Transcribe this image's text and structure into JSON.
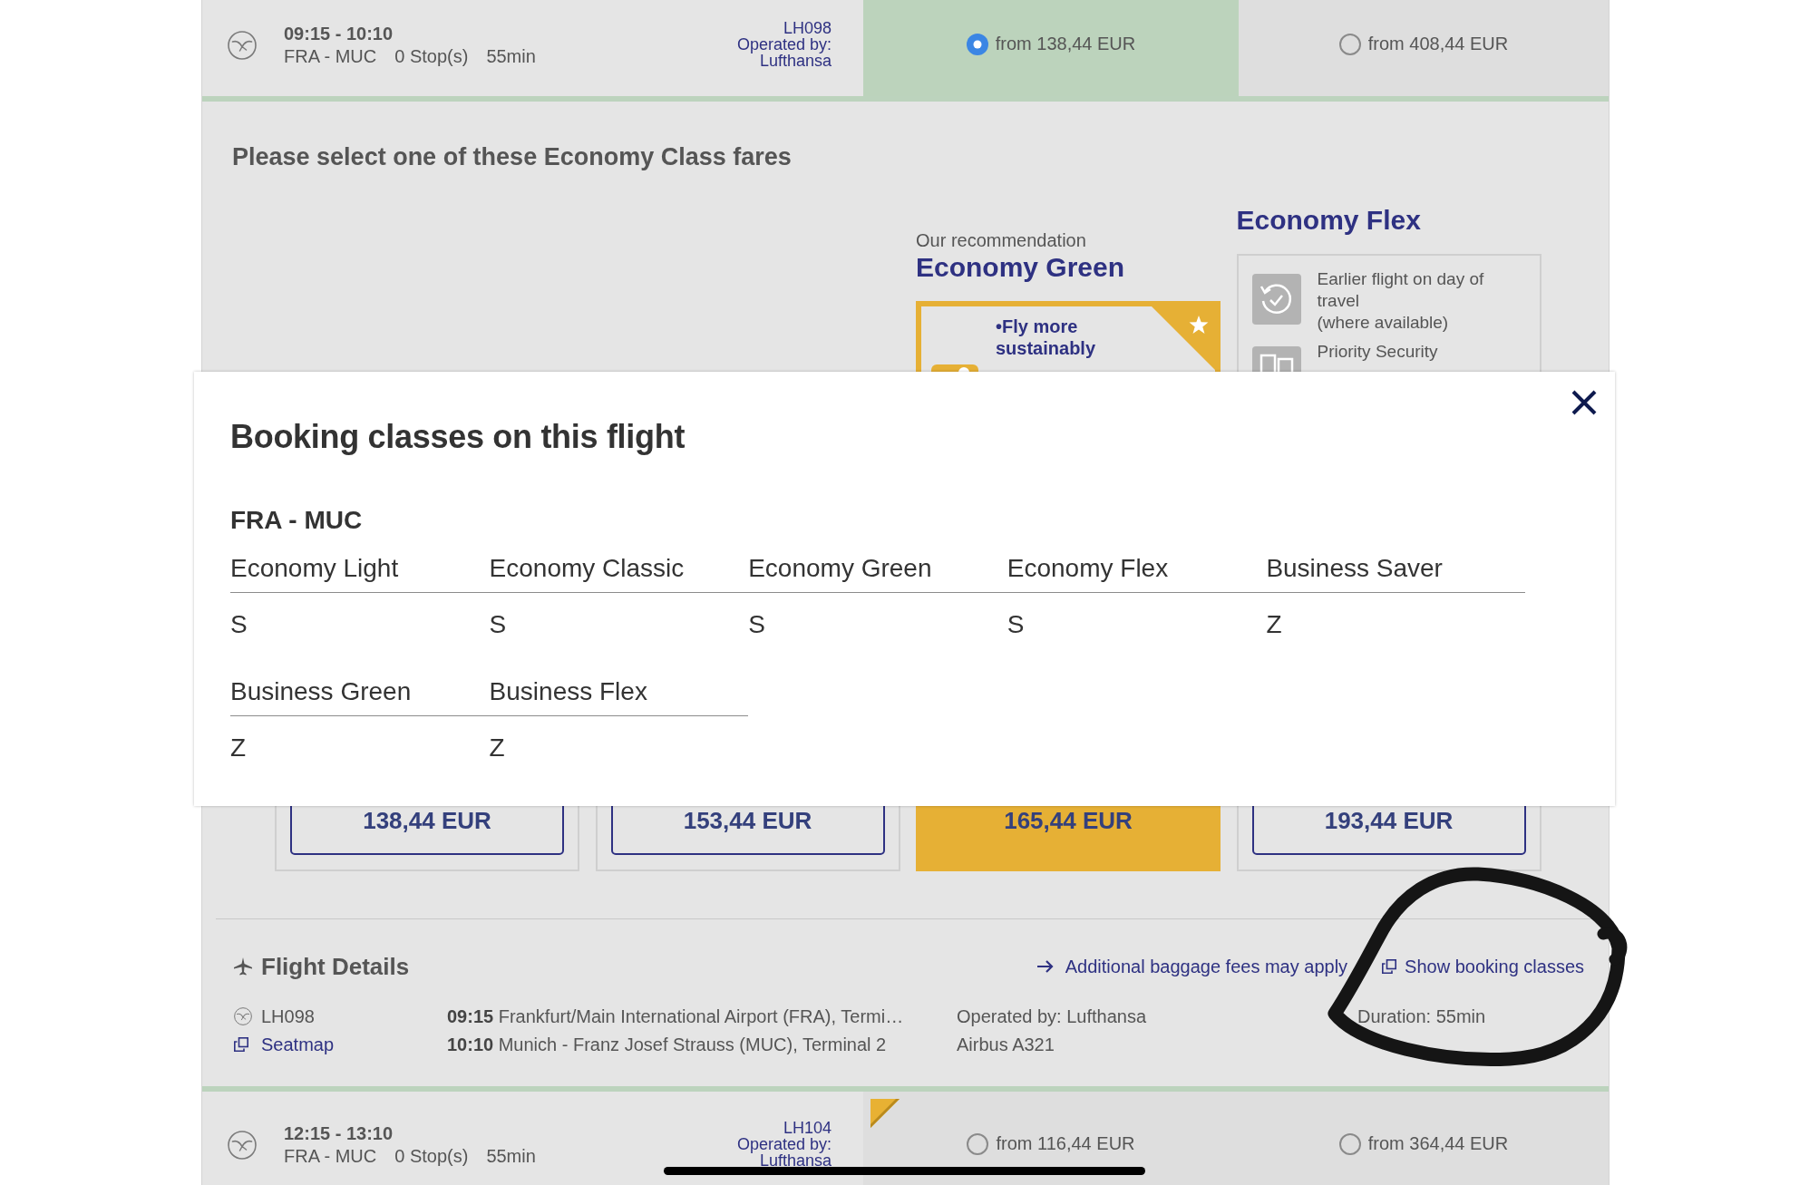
{
  "flights": [
    {
      "times": "09:15 - 10:10",
      "route": "FRA - MUC",
      "stops": "0 Stop(s)",
      "duration": "55min",
      "flight_number": "LH098",
      "operated_by": "Operated by:",
      "carrier": "Lufthansa",
      "fares": [
        {
          "label": "from 138,44 EUR",
          "selected": true,
          "flagged": false
        },
        {
          "label": "from 408,44 EUR",
          "selected": false,
          "flagged": false
        }
      ],
      "expanded": true,
      "fare_panel": {
        "heading": "Please select one of these Economy Class fares",
        "options": [
          {
            "kind": "standard",
            "price": "138,44 EUR"
          },
          {
            "kind": "standard",
            "price": "153,44 EUR"
          },
          {
            "kind": "recommended",
            "tagline": "Our recommendation",
            "name": "Economy Green",
            "features": [
              {
                "kind": "sustainability",
                "text": "•Fly more sustainably"
              }
            ],
            "price": "165,44 EUR"
          },
          {
            "kind": "standard",
            "name": "Economy Flex",
            "features": [
              {
                "kind": "rebooking",
                "text": "Earlier flight on day of travel\n(where available)"
              },
              {
                "kind": "security",
                "text": "Priority Security"
              }
            ],
            "price": "193,44 EUR"
          }
        ]
      },
      "details": {
        "title": "Flight Details",
        "links": [
          {
            "kind": "info",
            "label": "Additional baggage fees may apply"
          },
          {
            "kind": "popup",
            "label": "Show booking classes"
          }
        ],
        "flight_number": "LH098",
        "seatmap_link": "Seatmap",
        "departure": "**09:15** Frankfurt/Main International Airport (FRA), Termi…",
        "arrival": "**10:10** Munich - Franz Josef Strauss (MUC), Terminal 2",
        "operator": "Operated by: Lufthansa",
        "aircraft": "Airbus A321",
        "duration": "Duration: 55min"
      }
    },
    {
      "times": "12:15 - 13:10",
      "route": "FRA - MUC",
      "stops": "0 Stop(s)",
      "duration": "55min",
      "flight_number": "LH104",
      "operated_by": "Operated by:",
      "carrier": "Lufthansa",
      "fares": [
        {
          "label": "from 116,44 EUR",
          "selected": false,
          "flagged": true
        },
        {
          "label": "from 364,44 EUR",
          "selected": false,
          "flagged": false
        }
      ],
      "expanded": false
    }
  ],
  "booking_classes_dialog": {
    "title": "Booking classes on this flight",
    "segments": [
      {
        "route": "FRA - MUC",
        "classes": [
          {
            "name": "Economy Light",
            "code": "S"
          },
          {
            "name": "Economy Classic",
            "code": "S"
          },
          {
            "name": "Economy Green",
            "code": "S"
          },
          {
            "name": "Economy Flex",
            "code": "S"
          },
          {
            "name": "Business Saver",
            "code": "Z"
          },
          {
            "name": "Business Green",
            "code": "Z"
          },
          {
            "name": "Business Flex",
            "code": "Z"
          }
        ]
      }
    ]
  }
}
